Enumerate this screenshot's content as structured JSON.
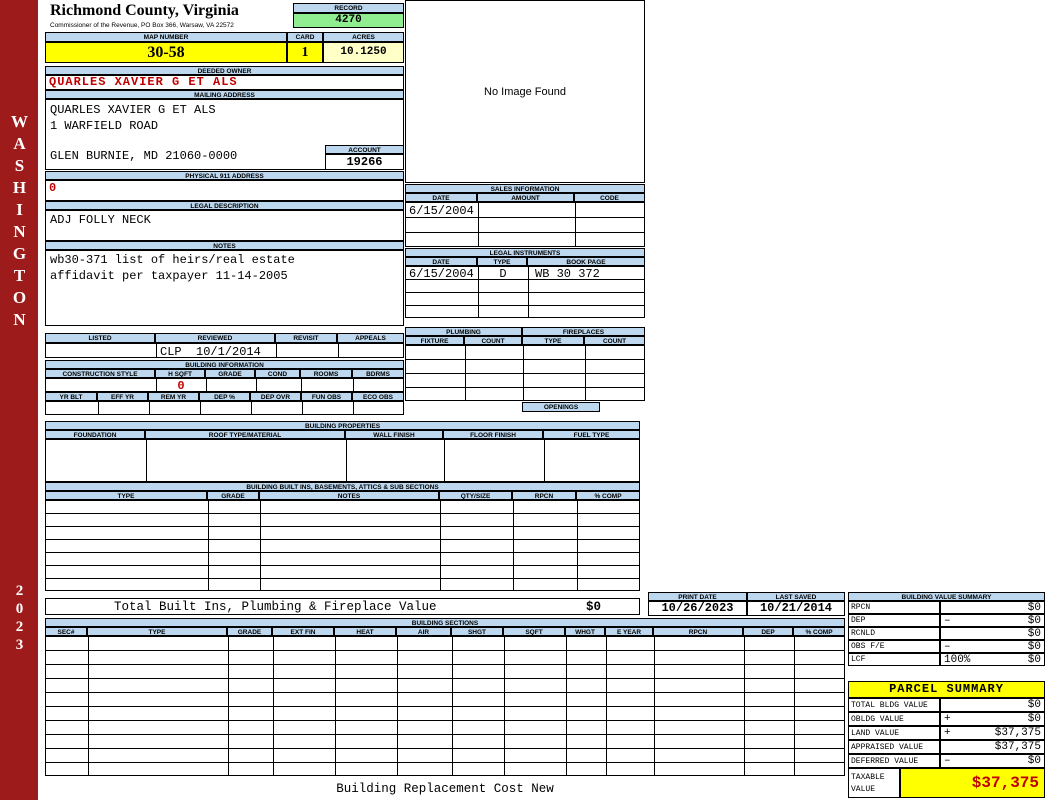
{
  "sidebar": {
    "state_text": "WASHINGTON",
    "year": "2023"
  },
  "county": {
    "title": "Richmond County, Virginia",
    "subtitle": "Commissioner of the Revenue, PO Box 366, Warsaw, VA 22572"
  },
  "record": {
    "label": "RECORD",
    "value": "4270"
  },
  "map": {
    "label": "MAP NUMBER",
    "value": "30-58"
  },
  "card": {
    "label": "CARD",
    "value": "1"
  },
  "acres": {
    "label": "ACRES",
    "value": "10.1250"
  },
  "deeded_owner": {
    "label": "DEEDED OWNER",
    "value": "QUARLES XAVIER G ET ALS"
  },
  "mailing": {
    "label": "MAILING ADDRESS",
    "line1": "QUARLES XAVIER G ET ALS",
    "line2": "1 WARFIELD ROAD",
    "line3": "GLEN BURNIE, MD 21060-0000"
  },
  "account": {
    "label": "ACCOUNT",
    "value": "19266"
  },
  "physical": {
    "label": "PHYSICAL 911 ADDRESS",
    "value": "0"
  },
  "legal_desc": {
    "label": "LEGAL DESCRIPTION",
    "value": "ADJ FOLLY NECK"
  },
  "notes": {
    "label": "NOTES",
    "line1": "wb30-371 list of heirs/real estate",
    "line2": "affidavit per taxpayer 11-14-2005"
  },
  "image_box": {
    "text": "No Image Found"
  },
  "sales": {
    "title": "SALES INFORMATION",
    "col_date": "DATE",
    "col_amount": "AMOUNT",
    "col_code": "CODE",
    "row1_date": "6/15/2004"
  },
  "instruments": {
    "title": "LEGAL INSTRUMENTS",
    "col_date": "DATE",
    "col_type": "TYPE",
    "col_book": "BOOK PAGE",
    "row1_date": "6/15/2004",
    "row1_type": "D",
    "row1_book": "WB 30 372"
  },
  "review": {
    "col_listed": "LISTED",
    "col_reviewed": "REVIEWED",
    "col_revisit": "REVISIT",
    "col_appeals": "APPEALS",
    "reviewed_value": "CLP  10/1/2014"
  },
  "plumbing": {
    "title": "PLUMBING",
    "col_fixture": "FIXTURE",
    "col_count": "COUNT"
  },
  "fireplaces": {
    "title": "FIREPLACES",
    "col_type": "TYPE",
    "col_count": "COUNT",
    "openings": "OPENINGS"
  },
  "bldg_info": {
    "title": "BUILDING INFORMATION",
    "cols1": [
      "CONSTRUCTION STYLE",
      "H SQFT",
      "GRADE",
      "COND",
      "ROOMS",
      "BDRMS"
    ],
    "hsqft_value": "0",
    "cols2": [
      "YR BLT",
      "EFF YR",
      "REM YR",
      "DEP %",
      "DEP OVR",
      "FUN OBS",
      "ECO OBS"
    ]
  },
  "bldg_props": {
    "title": "BUILDING PROPERTIES",
    "cols": [
      "FOUNDATION",
      "ROOF TYPE/MATERIAL",
      "WALL FINISH",
      "FLOOR FINISH",
      "FUEL TYPE"
    ]
  },
  "built_ins": {
    "title": "BUILDING BUILT INS, BASEMENTS, ATTICS & SUB SECTIONS",
    "cols": [
      "TYPE",
      "GRADE",
      "NOTES",
      "QTY/SIZE",
      "RPCN",
      "% COMP"
    ],
    "total_label": "Total Built Ins, Plumbing & Fireplace Value",
    "total_value": "$0"
  },
  "dates": {
    "print_label": "PRINT DATE",
    "print_value": "10/26/2023",
    "saved_label": "LAST SAVED",
    "saved_value": "10/21/2014"
  },
  "bldg_value_summary": {
    "title": "BUILDING VALUE SUMMARY",
    "rows": [
      {
        "label": "RPCN",
        "op": "",
        "value": "$0"
      },
      {
        "label": "DEP",
        "op": "–",
        "value": "$0"
      },
      {
        "label": "RCNLD",
        "op": "",
        "value": "$0"
      },
      {
        "label": "OBS F/E",
        "op": "–",
        "value": "$0"
      },
      {
        "label": "LCF",
        "op": "100%",
        "value": "$0"
      }
    ]
  },
  "bldg_sections": {
    "title": "BUILDING SECTIONS",
    "cols": [
      "SEC#",
      "TYPE",
      "GRADE",
      "EXT FIN",
      "HEAT",
      "AIR",
      "SHGT",
      "SQFT",
      "WHGT",
      "E YEAR",
      "RPCN",
      "DEP",
      "% COMP"
    ]
  },
  "parcel_summary": {
    "title": "PARCEL SUMMARY",
    "rows": [
      {
        "label": "TOTAL BLDG VALUE",
        "op": "",
        "value": "$0"
      },
      {
        "label": "OBLDG VALUE",
        "op": "+",
        "value": "$0"
      },
      {
        "label": "LAND VALUE",
        "op": "+",
        "value": "$37,375"
      },
      {
        "label": "APPRAISED VALUE",
        "op": "",
        "value": "$37,375"
      },
      {
        "label": "DEFERRED VALUE",
        "op": "–",
        "value": "$0"
      }
    ],
    "taxable_label_1": "TAXABLE",
    "taxable_label_2": "VALUE",
    "taxable_value": "$37,375"
  },
  "footer": {
    "text": "Building Replacement Cost New"
  },
  "colors": {
    "sidebar_red": "#9E1B1B",
    "header_bar_blue": "#BDD7EE",
    "highlight_yellow": "#FFFF00",
    "record_green": "#90EE90",
    "acres_cream": "#FFFFC8",
    "alert_red": "#C00000"
  }
}
